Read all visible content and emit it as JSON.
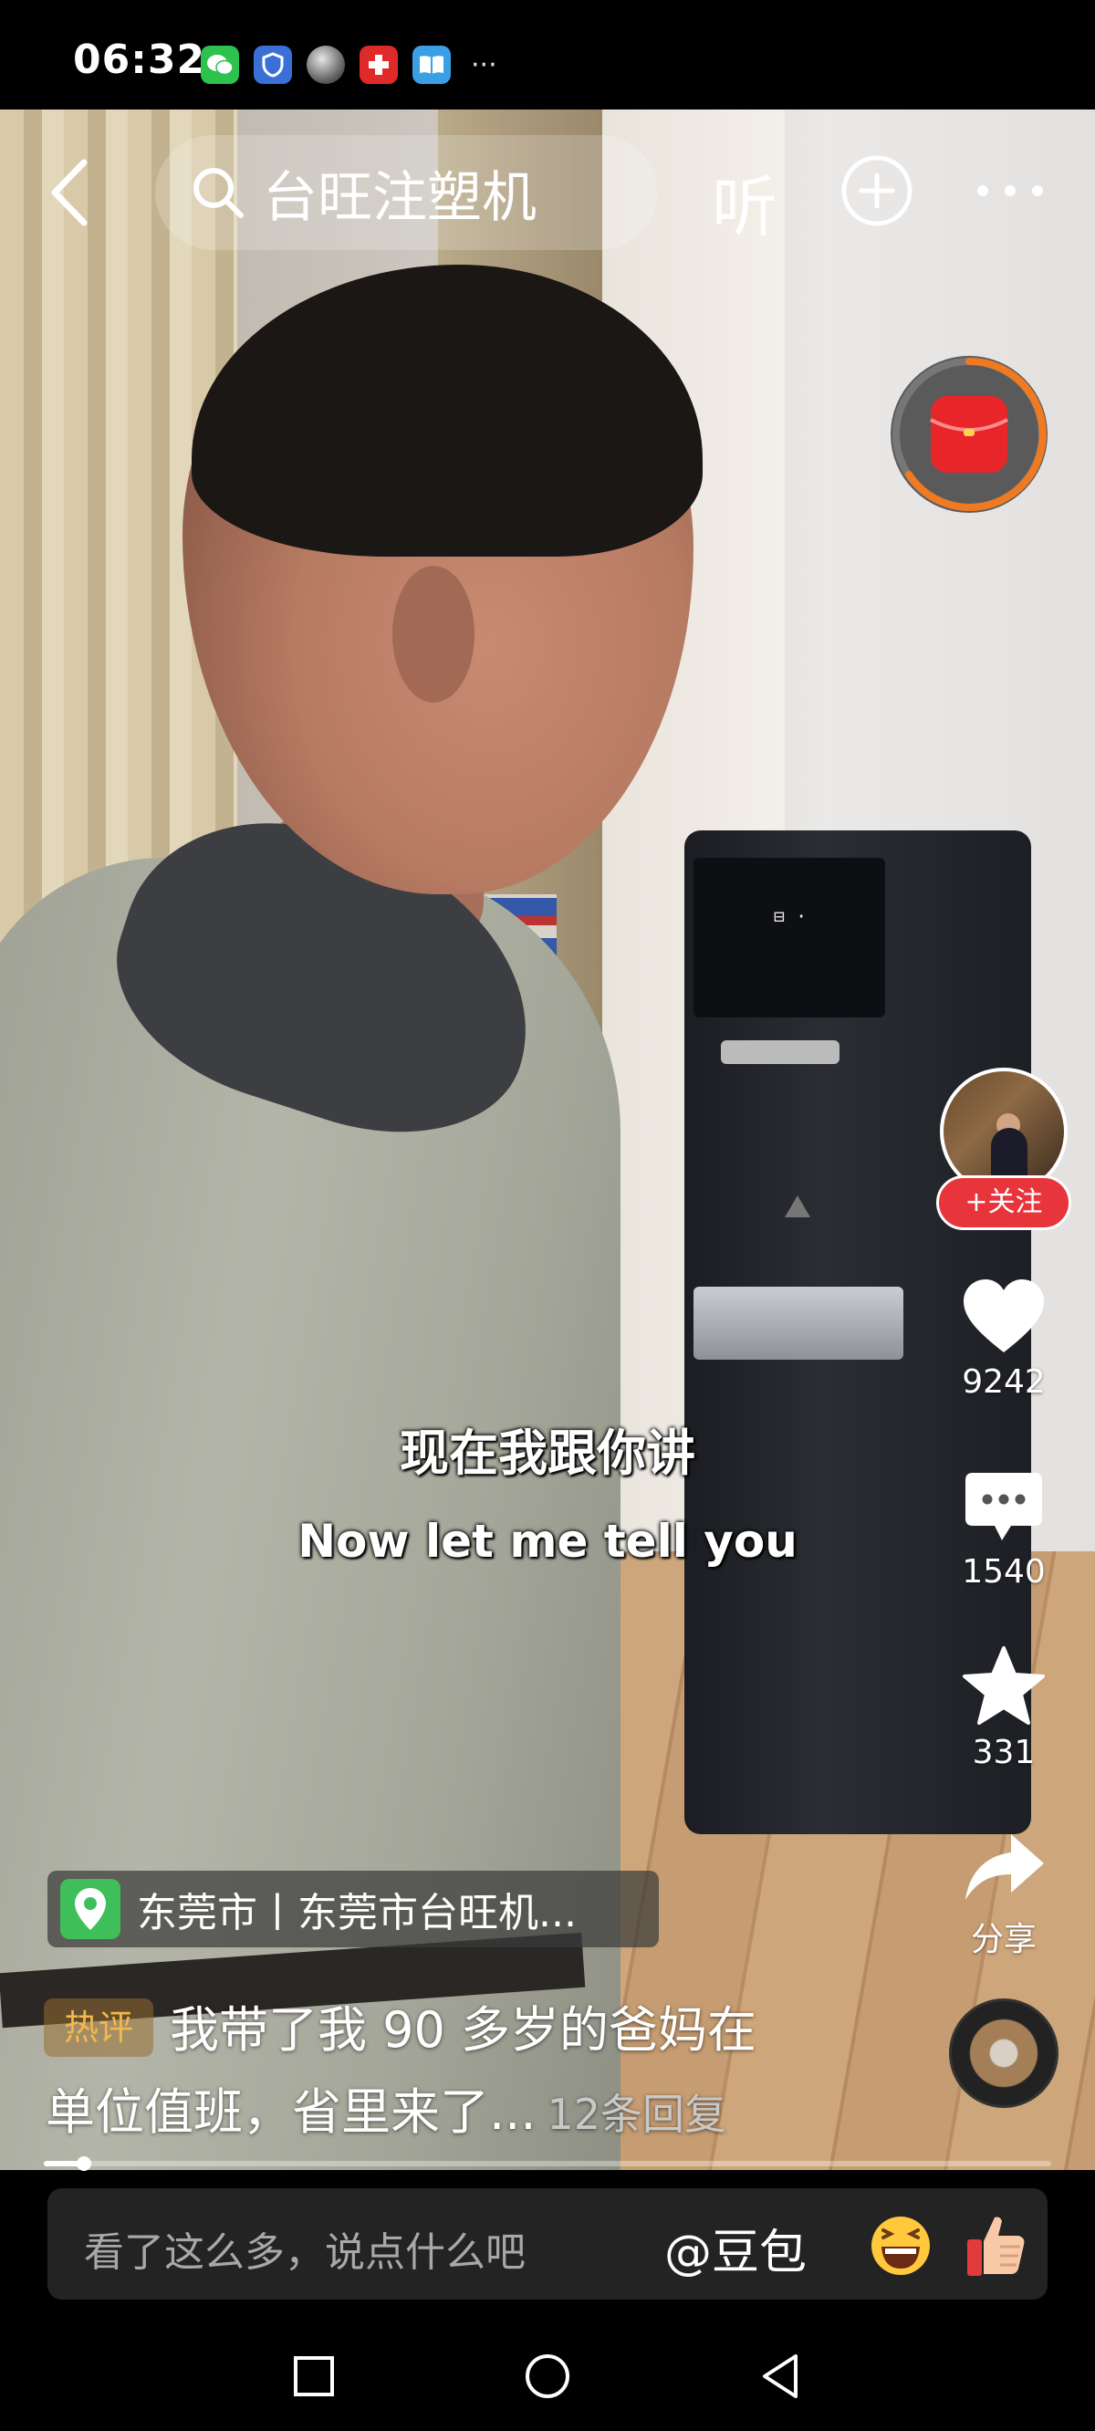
{
  "status_bar": {
    "time": "06:32",
    "app_icons": [
      "wechat-icon",
      "security-shield-icon",
      "moon-icon",
      "red-cross-app-icon",
      "book-icon"
    ],
    "more": "···"
  },
  "top_nav": {
    "search_query": "台旺注塑机",
    "listen_label": "听"
  },
  "subtitles": {
    "chinese": "现在我跟你讲",
    "english": "Now let me tell you"
  },
  "right_rail": {
    "follow_label": "+关注",
    "likes": "9242",
    "comments": "1540",
    "favorites": "331",
    "share_label": "分享"
  },
  "location": {
    "text": "东莞市丨东莞市台旺机..."
  },
  "hot_comment": {
    "badge": "热评",
    "line1": "我带了我 90 多岁的爸妈在",
    "line2": "单位值班，省里来了...",
    "replies": "12条回复"
  },
  "playback": {
    "progress_fraction": 0.04
  },
  "comment_bar": {
    "placeholder": "看了这么多，说点什么吧",
    "mention": "@豆包"
  },
  "colors": {
    "follow_red": "#e8353c",
    "location_green": "#3fbf5a",
    "hot_badge_gold": "#f2b84a",
    "redpacket_ring": "#f07a22"
  }
}
